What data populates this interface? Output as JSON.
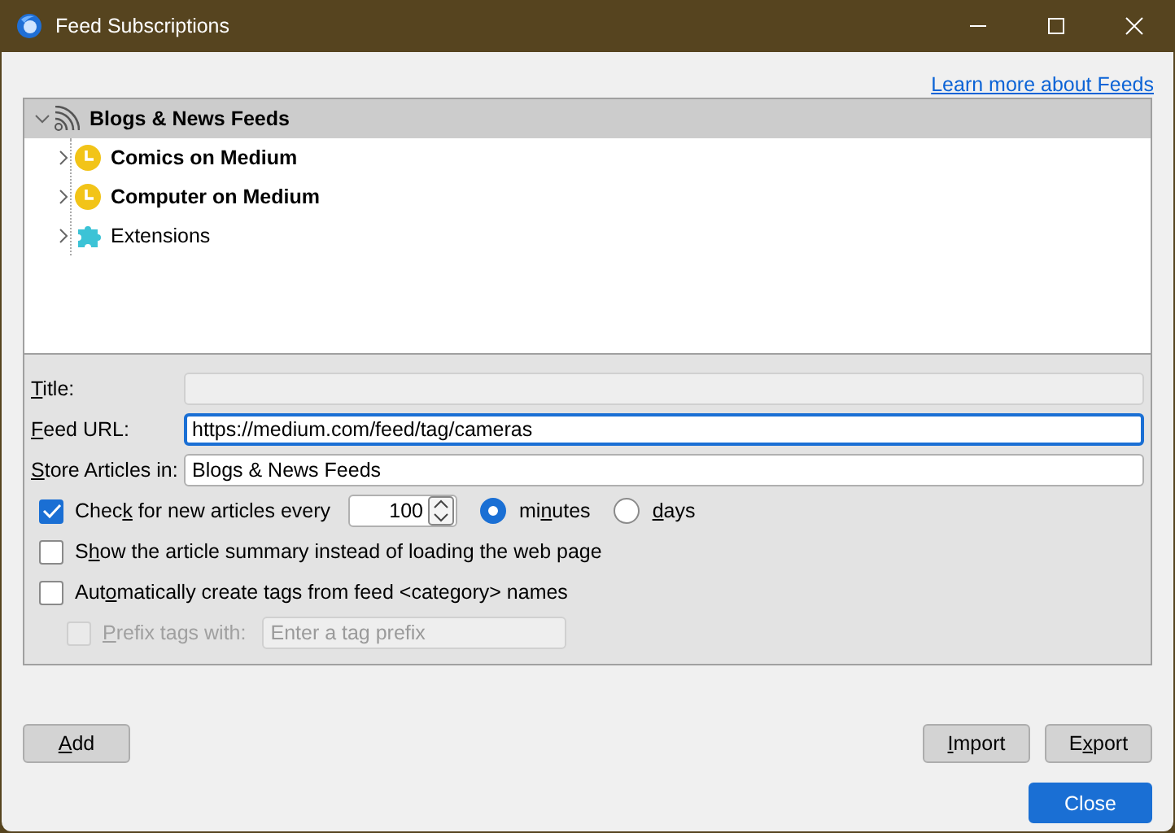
{
  "window": {
    "title": "Feed Subscriptions"
  },
  "link": "Learn more about Feeds",
  "tree": {
    "label": "Blogs & News Feeds",
    "kind": "rss",
    "expanded": true,
    "selected": true,
    "unread": true,
    "children": [
      {
        "label": "Comics on Medium",
        "kind": "clock",
        "expanded": false,
        "selected": false,
        "unread": true
      },
      {
        "label": "Computer on Medium",
        "kind": "clock",
        "expanded": false,
        "selected": false,
        "unread": true
      },
      {
        "label": "Extensions",
        "kind": "puzzle",
        "expanded": false,
        "selected": false,
        "unread": false
      }
    ]
  },
  "fields": [
    {
      "label": {
        "key": "T",
        "post": "itle:"
      },
      "disabled": true,
      "focused": false
    },
    {
      "label": {
        "key": "F",
        "post": "eed URL:"
      },
      "value": "https://medium.com/feed/tag/cameras",
      "disabled": false,
      "focused": true
    },
    {
      "label": {
        "key": "S",
        "post": "tore Articles in:"
      },
      "value": "Blogs & News Feeds",
      "disabled": false,
      "focused": false
    }
  ],
  "options": [
    {
      "kind": "interval",
      "checked": true,
      "disabled": false,
      "label": {
        "pre": "Chec",
        "key": "k",
        "post": " for new articles every"
      },
      "value": "100",
      "units": [
        {
          "label": {
            "pre": "mi",
            "key": "n",
            "post": "utes"
          },
          "selected": true
        },
        {
          "label": {
            "key": "d",
            "post": "ays"
          },
          "selected": false
        }
      ]
    },
    {
      "kind": "check",
      "checked": false,
      "disabled": false,
      "label": {
        "pre": "S",
        "key": "h",
        "post": "ow the article summary instead of loading the web page"
      }
    },
    {
      "kind": "check",
      "checked": false,
      "disabled": false,
      "label": {
        "pre": "Aut",
        "key": "o",
        "post": "matically create tags from feed <category> names"
      }
    },
    {
      "kind": "prefix",
      "checked": false,
      "disabled": true,
      "label": {
        "key": "P",
        "post": "refix tags with:"
      },
      "placeholder": "Enter a tag prefix"
    }
  ],
  "buttons": [
    {
      "label": {
        "key": "A",
        "post": "dd"
      },
      "kind": "left"
    },
    {
      "label": {
        "key": "I",
        "post": "mport"
      },
      "kind": "right"
    },
    {
      "label": {
        "pre": "E",
        "key": "x",
        "post": "port"
      },
      "kind": "right"
    },
    {
      "label": {
        "pre": "Close"
      },
      "kind": "primary"
    }
  ]
}
